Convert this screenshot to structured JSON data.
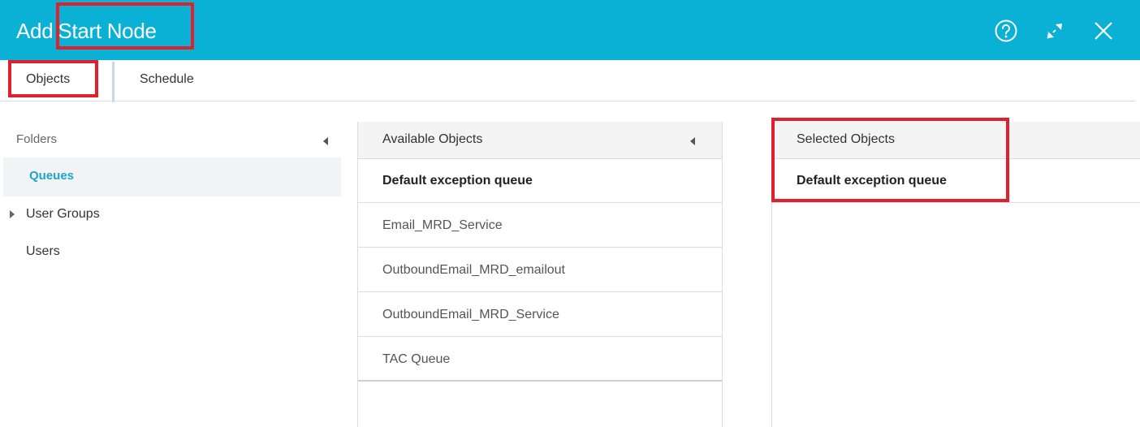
{
  "dialog": {
    "title_prefix": "Add",
    "title_main": "Start Node",
    "accent_color": "#0ab1d5",
    "highlight_color": "#e0202e",
    "icons": [
      "help-icon",
      "expand-icon",
      "close-icon"
    ]
  },
  "tabs": {
    "objects_label": "Objects",
    "schedule_label": "Schedule"
  },
  "folders": {
    "title": "Folders",
    "items": [
      "Queues",
      "User Groups",
      "Users"
    ],
    "selected": "Queues"
  },
  "available": {
    "title": "Available Objects",
    "items": [
      "Default exception queue",
      "Email_MRD_Service",
      "OutboundEmail_MRD_emailout",
      "OutboundEmail_MRD_Service",
      "TAC Queue"
    ]
  },
  "selected": {
    "title": "Selected Objects",
    "items": [
      "Default exception queue"
    ]
  }
}
